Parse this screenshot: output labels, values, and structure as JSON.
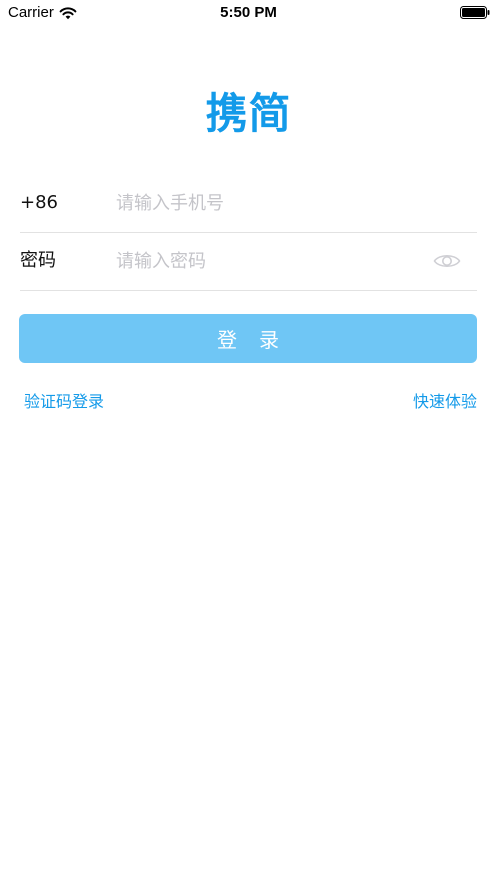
{
  "status_bar": {
    "carrier": "Carrier",
    "time": "5:50 PM"
  },
  "app": {
    "title": "携简"
  },
  "form": {
    "phone": {
      "label": "+86",
      "placeholder": "请输入手机号",
      "value": ""
    },
    "password": {
      "label": "密码",
      "placeholder": "请输入密码",
      "value": ""
    },
    "login_label": "登录"
  },
  "links": {
    "sms_login": "验证码登录",
    "quick_trial": "快速体验"
  },
  "colors": {
    "accent": "#139ae9",
    "button": "#6fc6f5",
    "divider": "#e2e2e2",
    "placeholder": "#c4c4c9"
  },
  "icons": {
    "wifi": "wifi-icon",
    "battery": "battery-icon",
    "password_toggle": "eye-icon"
  }
}
